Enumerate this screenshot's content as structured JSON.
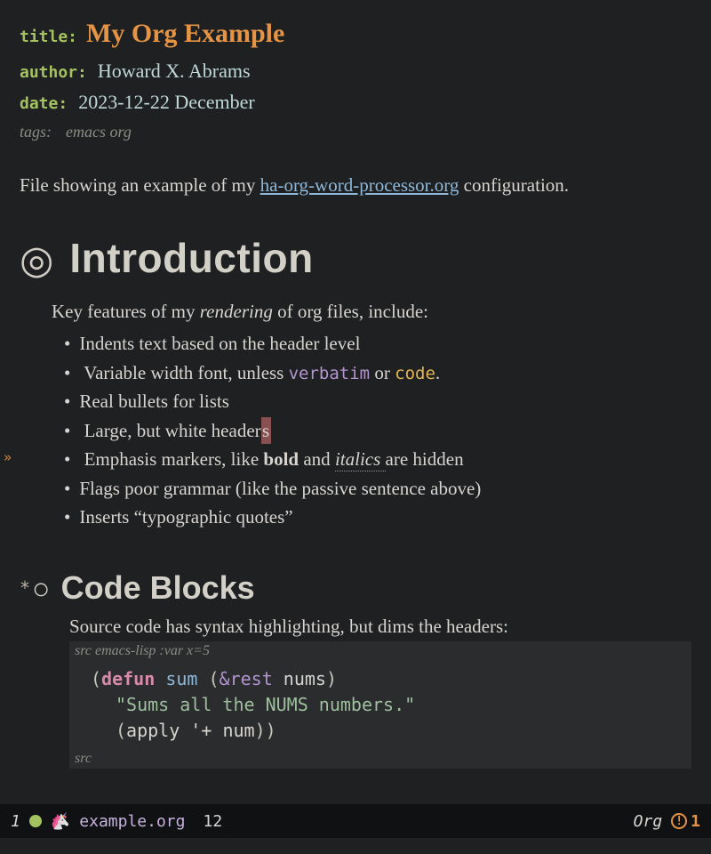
{
  "meta": {
    "title_label": "title:",
    "title": "My Org Example",
    "author_label": "author:",
    "author": "Howard X. Abrams",
    "date_label": "date:",
    "date": "2023-12-22 December",
    "tags_label": "tags:",
    "tags": "emacs org"
  },
  "intro": {
    "pre": "File showing an example of my ",
    "link": "ha-org-word-processor.org",
    "post": " configuration."
  },
  "sections": {
    "intro_h": "Introduction",
    "intro_lead_pre": "Key features of my ",
    "intro_lead_em": "rendering",
    "intro_lead_post": " of org files, include:",
    "bullets": {
      "b0": "Indents text based on the header level",
      "b1_pre": "Variable width font, unless ",
      "b1_verb": "verbatim",
      "b1_mid": " or ",
      "b1_code": "code",
      "b1_post": ".",
      "b2": "Real bullets for lists",
      "b3_pre": "Large, but white header",
      "b3_cursor": "s",
      "b4_pre": "Emphasis markers, like ",
      "b4_bold": "bold",
      "b4_mid": " and ",
      "b4_ital": "italics ",
      "b4_post": "are hidden",
      "b5": "Flags poor grammar (like the passive sentence above)",
      "b6": "Inserts “typographic quotes”"
    },
    "code_h": "Code Blocks",
    "code_desc": "Source code has syntax highlighting, but dims the headers:",
    "src_header_pre": "src ",
    "src_header_lang": "emacs-lisp :var x=5",
    "src_footer": "src",
    "code": {
      "l1_open": "(",
      "l1_defun": "defun",
      "l1_sp1": " ",
      "l1_fn": "sum",
      "l1_sp2": " (",
      "l1_rest": "&rest",
      "l1_sp3": " ",
      "l1_arg": "nums",
      "l1_close": ")",
      "l2": "\"Sums all the NUMS numbers.\"",
      "l3_open": "(",
      "l3_apply": "apply",
      "l3_mid": " '",
      "l3_plus": "+",
      "l3_sp": " ",
      "l3_num": "num",
      "l3_close": "))"
    }
  },
  "fringe": {
    "mark": "»"
  },
  "modeline": {
    "window_number": "1",
    "buffer": "example.org",
    "line": "12",
    "mode": "Org",
    "warn_count": "1",
    "warn_glyph": "!"
  }
}
